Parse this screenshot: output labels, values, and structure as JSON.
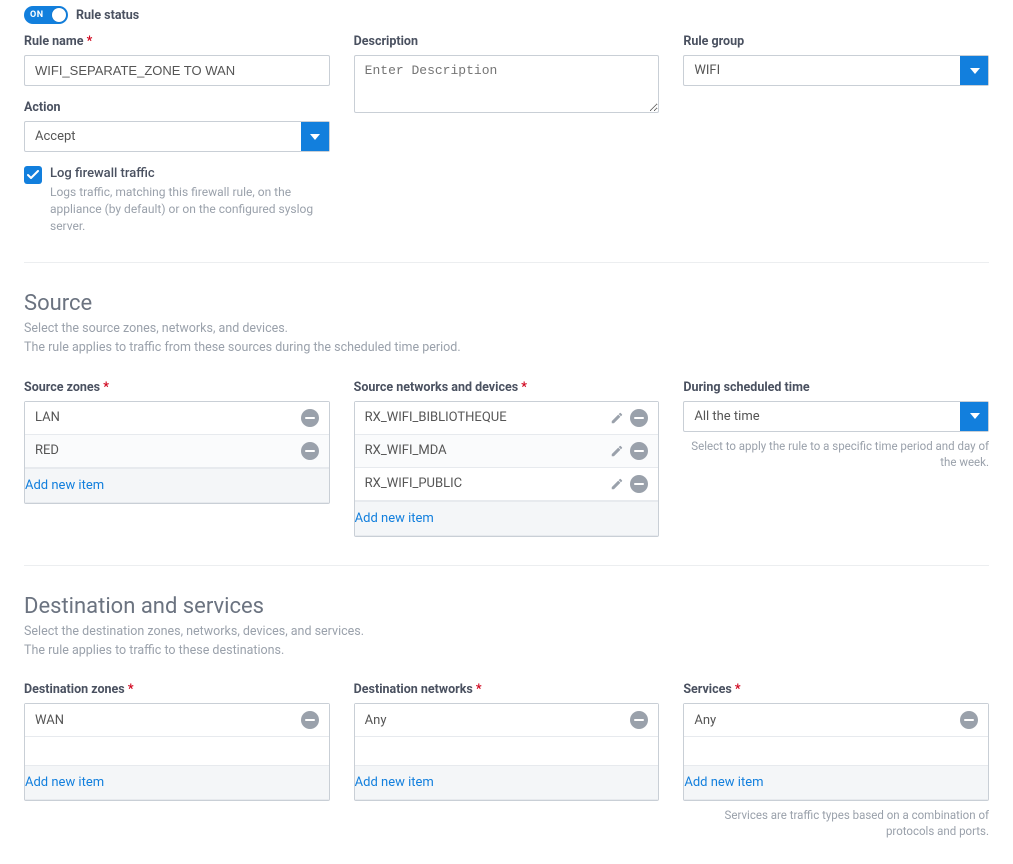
{
  "toggle": {
    "state": "ON",
    "label": "Rule status"
  },
  "ruleName": {
    "label": "Rule name",
    "required": "*",
    "value": "WIFI_SEPARATE_ZONE TO WAN"
  },
  "description": {
    "label": "Description",
    "placeholder": "Enter Description",
    "value": ""
  },
  "ruleGroup": {
    "label": "Rule group",
    "value": "WIFI"
  },
  "action": {
    "label": "Action",
    "value": "Accept"
  },
  "logTraffic": {
    "label": "Log firewall traffic",
    "desc": "Logs traffic, matching this firewall rule, on the appliance (by default) or on the configured syslog server."
  },
  "source": {
    "heading": "Source",
    "sub1": "Select the source zones, networks, and devices.",
    "sub2": "The rule applies to traffic from these sources during the scheduled time period.",
    "zonesLabel": "Source zones",
    "zonesReq": "*",
    "zones": [
      "LAN",
      "RED"
    ],
    "networksLabel": "Source networks and devices",
    "networksReq": "*",
    "networks": [
      "RX_WIFI_BIBLIOTHEQUE",
      "RX_WIFI_MDA",
      "RX_WIFI_PUBLIC"
    ],
    "scheduleLabel": "During scheduled time",
    "scheduleValue": "All the time",
    "scheduleHelp": "Select to apply the rule to a specific time period and day of the week."
  },
  "destination": {
    "heading": "Destination and services",
    "sub1": "Select the destination zones, networks, devices, and services.",
    "sub2": "The rule applies to traffic to these destinations.",
    "zonesLabel": "Destination zones",
    "zonesReq": "*",
    "zones": [
      "WAN"
    ],
    "networksLabel": "Destination networks",
    "networksReq": "*",
    "networks": [
      "Any"
    ],
    "servicesLabel": "Services",
    "servicesReq": "*",
    "services": [
      "Any"
    ],
    "servicesHelp": "Services are traffic types based on a combination of protocols and ports."
  },
  "addNew": "Add new item"
}
